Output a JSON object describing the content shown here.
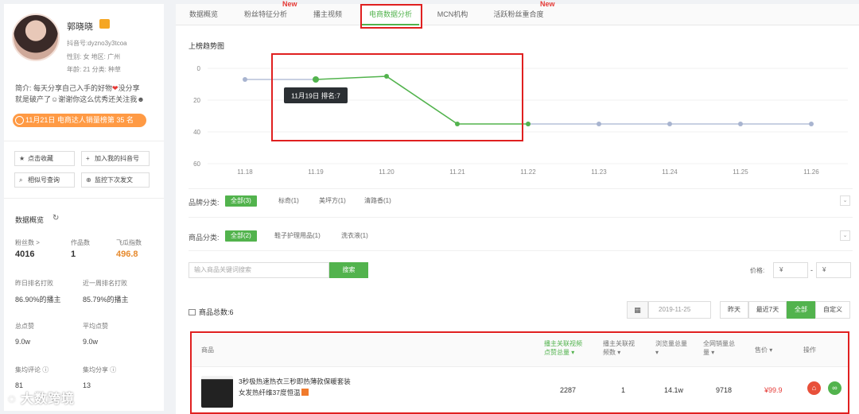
{
  "profile": {
    "name": "郭晓晓",
    "douyin_id": "抖音号:dyzno3y3tcoa",
    "gender_region": "性别: 女  地区: 广州",
    "age_category": "年龄: 21  分类: 种草",
    "bio_line1": "简介: 每天分享自己入手的好物",
    "bio_line1_tail": "没分享",
    "bio_line2": "就是破产了",
    "bio_line2_tail": "谢谢你这么优秀还关注我",
    "rank_text": "11月21日 电商达人销量榜第 35 名"
  },
  "actions": {
    "favorite": "点击收藏",
    "add_mine": "加入我的抖音号",
    "similar": "相似号查询",
    "monitor": "监控下次发文"
  },
  "overview": {
    "title": "数据概览",
    "fans_label": "粉丝数 >",
    "fans_value": "4016",
    "works_label": "作品数",
    "works_value": "1",
    "index_label": "飞瓜指数",
    "index_value": "496.8",
    "yday_rank_label": "昨日排名打败",
    "yday_rank_value": "86.90%的播主",
    "week_rank_label": "近一周排名打败",
    "week_rank_value": "85.79%的播主",
    "total_likes_label": "总点赞",
    "total_likes_value": "9.0w",
    "avg_likes_label": "平均点赞",
    "avg_likes_value": "9.0w",
    "avg_comments_label": "集均评论 ⓘ",
    "avg_comments_value": "81",
    "avg_shares_label": "集均分享 ⓘ",
    "avg_shares_value": "13"
  },
  "tabs": [
    {
      "label": "数据概览"
    },
    {
      "label": "粉丝特征分析",
      "badge": "New"
    },
    {
      "label": "播主视频"
    },
    {
      "label": "电商数据分析"
    },
    {
      "label": "MCN机构"
    },
    {
      "label": "活跃粉丝重合度",
      "badge": "New"
    }
  ],
  "chart_title": "上榜趋势图",
  "chart_data": {
    "type": "line",
    "categories": [
      "11.18",
      "11.19",
      "11.20",
      "11.21",
      "11.22",
      "11.23",
      "11.24",
      "11.25",
      "11.26"
    ],
    "series": [
      {
        "values": [
          7,
          7,
          null,
          null,
          35,
          35,
          35,
          35,
          35
        ]
      },
      {
        "values": [
          null,
          7,
          5,
          35,
          35,
          null,
          null,
          null,
          null
        ]
      }
    ],
    "y_ticks": [
      "0",
      "20",
      "40",
      "60"
    ],
    "ylim": [
      0,
      60
    ],
    "y_reversed": true,
    "tooltip": "11月19日 排名:7",
    "colors": {
      "gray": "#a8b4d0",
      "green": "#52b34d"
    }
  },
  "brand_filter": {
    "label": "品牌分类:",
    "chips": [
      "全部(3)",
      "标奇(1)",
      "美坪方(1)",
      "清路香(1)"
    ]
  },
  "goods_filter": {
    "label": "商品分类:",
    "chips": [
      "全部(2)",
      "鞋子护理用品(1)",
      "洗衣液(1)"
    ]
  },
  "search": {
    "placeholder": "输入商品关键词搜索",
    "button": "搜索",
    "price_label": "价格:",
    "price_min": "¥",
    "price_sep": "-",
    "price_max": "¥"
  },
  "goods_count": "商品总数:6",
  "date_filter": {
    "date": "2019-11-25",
    "ranges": [
      "昨天",
      "最近7天",
      "全部",
      "自定义"
    ]
  },
  "table": {
    "headers": {
      "product": "商品",
      "views": "播主关联视频点赞总量",
      "video_count": "播主关联视频数",
      "browse": "浏览量总量",
      "sales": "全网销量总量",
      "price": "售价",
      "ops": "操作"
    },
    "row": {
      "name_line1": "3秒极热速热衣三秒即热薄款保暖套装",
      "name_line2": "女发热纤维37度恒温",
      "views": "2287",
      "video_count": "1",
      "browse": "14.1w",
      "sales": "9718",
      "price": "¥99.9"
    }
  },
  "watermark": "大数跨境",
  "accent": "#52b34d"
}
